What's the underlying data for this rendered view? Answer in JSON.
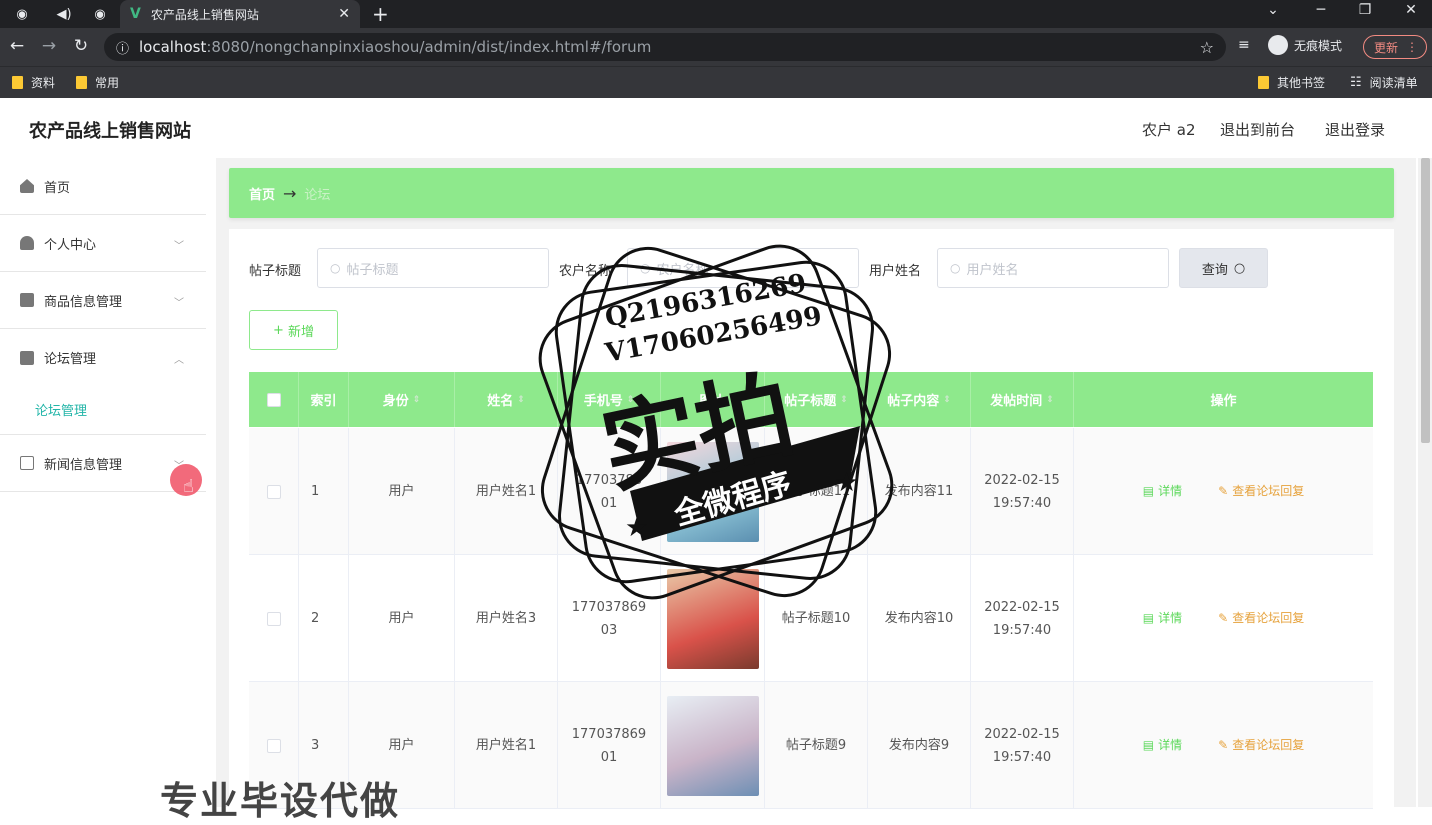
{
  "browser": {
    "tab_title": "农产品线上销售网站",
    "url_host": "localhost",
    "url_rest": ":8080/nongchanpinxiaoshou/admin/dist/index.html#/forum",
    "incognito_label": "无痕模式",
    "update_label": "更新",
    "bookmarks": [
      "资料",
      "常用"
    ],
    "bookmarks_right": [
      "其他书签",
      "阅读清单"
    ]
  },
  "header": {
    "site_title": "农产品线上销售网站",
    "user": "农户 a2",
    "to_front": "退出到前台",
    "logout": "退出登录"
  },
  "sidebar": {
    "items": [
      {
        "label": "首页"
      },
      {
        "label": "个人中心"
      },
      {
        "label": "商品信息管理"
      },
      {
        "label": "论坛管理"
      },
      {
        "label": "新闻信息管理"
      }
    ],
    "active_sub": "论坛管理"
  },
  "breadcrumb": {
    "home": "首页",
    "current": "论坛"
  },
  "filters": {
    "title_label": "帖子标题",
    "title_placeholder": "帖子标题",
    "farmer_label": "农户名称",
    "farmer_placeholder": "农户名称",
    "user_label": "用户姓名",
    "user_placeholder": "用户姓名",
    "query_label": "查询"
  },
  "add_label": "新增",
  "table": {
    "columns": [
      "索引",
      "身份",
      "姓名",
      "手机号",
      "图片",
      "帖子标题",
      "帖子内容",
      "发帖时间",
      "操作"
    ],
    "rows": [
      {
        "index": "1",
        "role": "用户",
        "name": "用户姓名1",
        "phone1": "17703786",
        "phone2": "01",
        "title": "帖子标题11",
        "content": "发布内容11",
        "date": "2022-02-15",
        "time": "19:57:40"
      },
      {
        "index": "2",
        "role": "用户",
        "name": "用户姓名3",
        "phone1": "177037869",
        "phone2": "03",
        "title": "帖子标题10",
        "content": "发布内容10",
        "date": "2022-02-15",
        "time": "19:57:40"
      },
      {
        "index": "3",
        "role": "用户",
        "name": "用户姓名1",
        "phone1": "177037869",
        "phone2": "01",
        "title": "帖子标题9",
        "content": "发布内容9",
        "date": "2022-02-15",
        "time": "19:57:40"
      }
    ],
    "detail_label": "详情",
    "reply_label": "查看论坛回复"
  },
  "watermark": {
    "line1": "Q2196316269",
    "line2": "V17060256499",
    "big": "实拍",
    "banner": "全微程序",
    "bottom": "专业毕设代做"
  }
}
